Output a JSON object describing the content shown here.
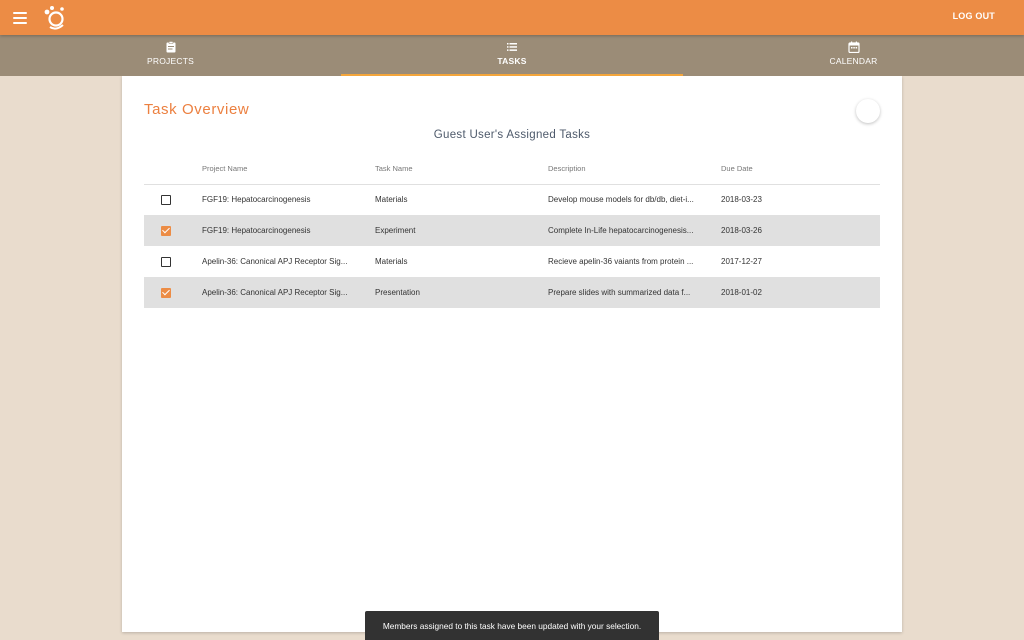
{
  "header": {
    "logout_label": "LOG OUT"
  },
  "nav": {
    "tabs": [
      {
        "label": "PROJECTS",
        "icon": "clipboard-icon"
      },
      {
        "label": "TASKS",
        "icon": "list-icon"
      },
      {
        "label": "CALENDAR",
        "icon": "calendar-icon"
      }
    ]
  },
  "card": {
    "title": "Task Overview",
    "subtitle": "Guest User's Assigned Tasks",
    "columns": [
      "Project Name",
      "Task Name",
      "Description",
      "Due Date"
    ],
    "rows": [
      {
        "checked": false,
        "project": "FGF19: Hepatocarcinogenesis",
        "task": "Materials",
        "description": "Develop mouse models for db/db, diet-i...",
        "due": "2018-03-23"
      },
      {
        "checked": true,
        "project": "FGF19: Hepatocarcinogenesis",
        "task": "Experiment",
        "description": "Complete In-Life hepatocarcinogenesis...",
        "due": "2018-03-26"
      },
      {
        "checked": false,
        "project": "Apelin-36: Canonical APJ Receptor Sig...",
        "task": "Materials",
        "description": "Recieve apelin-36 vaiants from protein ...",
        "due": "2017-12-27"
      },
      {
        "checked": true,
        "project": "Apelin-36: Canonical APJ Receptor Sig...",
        "task": "Presentation",
        "description": "Prepare slides with summarized data f...",
        "due": "2018-01-02"
      }
    ]
  },
  "snackbar": {
    "message": "Members assigned to this task have been updated with your selection."
  },
  "colors": {
    "accent": "#ec8c45",
    "nav": "#9b8c77",
    "background": "#e9dccd",
    "tab_indicator": "#f3a53b"
  }
}
